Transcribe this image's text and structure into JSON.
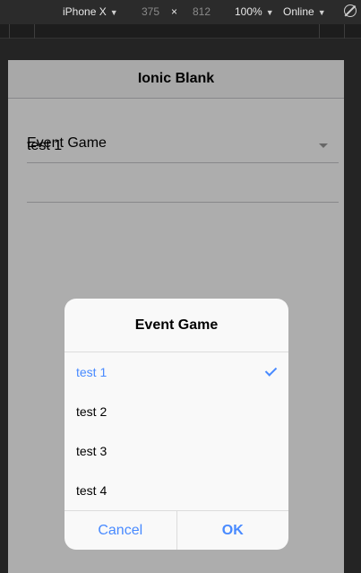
{
  "devtools": {
    "device": "iPhone X",
    "width": "375",
    "times": "×",
    "height": "812",
    "zoom": "100%",
    "network": "Online"
  },
  "app": {
    "title": "Ionic Blank",
    "select": {
      "label": "Event Game",
      "value": "test 1"
    }
  },
  "alert": {
    "title": "Event Game",
    "options": [
      {
        "label": "test 1",
        "checked": true
      },
      {
        "label": "test 2",
        "checked": false
      },
      {
        "label": "test 3",
        "checked": false
      },
      {
        "label": "test 4",
        "checked": false
      }
    ],
    "cancel_label": "Cancel",
    "ok_label": "OK"
  },
  "colors": {
    "accent": "#488aff",
    "backdrop": "rgba(0,0,0,0.32)"
  }
}
